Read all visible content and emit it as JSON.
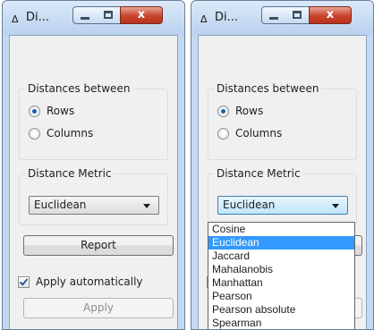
{
  "window": {
    "title": "Di...",
    "title_icon": "delta-icon",
    "close_glyph": "x"
  },
  "left": {
    "distances_group": {
      "legend": "Distances between",
      "options": [
        "Rows",
        "Columns"
      ],
      "selected": "Rows"
    },
    "metric_group": {
      "legend": "Distance Metric",
      "selected": "Euclidean"
    },
    "report_button": "Report",
    "apply_auto": {
      "label": "Apply automatically",
      "checked": true
    },
    "apply_button": "Apply"
  },
  "right": {
    "distances_group": {
      "legend": "Distances between",
      "options": [
        "Rows",
        "Columns"
      ],
      "selected": "Rows"
    },
    "metric_group": {
      "legend": "Distance Metric",
      "selected": "Euclidean"
    },
    "dropdown_options": [
      "Cosine",
      "Euclidean",
      "Jaccard",
      "Mahalanobis",
      "Manhattan",
      "Pearson",
      "Pearson absolute",
      "Spearman"
    ],
    "dropdown_selected_index": 1
  },
  "colors": {
    "frame": "#c2d9f1",
    "close_button": "#c9432c",
    "selection": "#3399ff"
  }
}
